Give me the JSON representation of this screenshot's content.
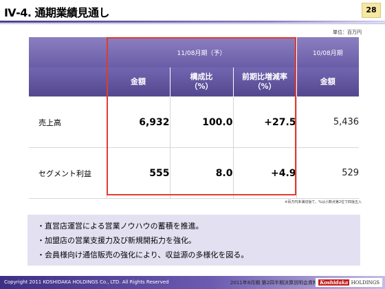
{
  "header": {
    "title": "Ⅳ-4. 通期業績見通し",
    "page_number": "28"
  },
  "unit_label": "単位：百万円",
  "table": {
    "current_period": "11/08月期（予）",
    "previous_period": "10/08月期",
    "columns": {
      "amount": "金額",
      "composition": "構成比\n（%）",
      "yoy": "前期比増減率\n（%）",
      "prev_amount": "金額"
    },
    "rows": [
      {
        "label": "売上高",
        "amount": "6,932",
        "composition": "100.0",
        "yoy": "+27.5",
        "prev": "5,436"
      },
      {
        "label": "セグメント利益",
        "amount": "555",
        "composition": "8.0",
        "yoy": "+4.9",
        "prev": "529"
      }
    ],
    "note": "※百万円未満切捨て、%は小数点第2位で四捨五入"
  },
  "bullets": [
    "直営店運営による営業ノウハウの蓄積を推進。",
    "加盟店の営業支援力及び新規開拓力を強化。",
    "会員様向け通信販売の強化により、収益源の多様化を図る。"
  ],
  "footer": {
    "copyright": "Copyright 2011 KOSHIDAKA HOLDINGS Co., LTD. All Rights Reserved",
    "document": "2011年8月期 第2四半期決算説明会資料",
    "logo_brand": "Koshidaka",
    "logo_suffix": "HOLDINGS"
  },
  "colors": {
    "header_purple": "#6a5da8",
    "highlight_red": "#e23b2a",
    "bullet_box": "#e3e0f2"
  }
}
